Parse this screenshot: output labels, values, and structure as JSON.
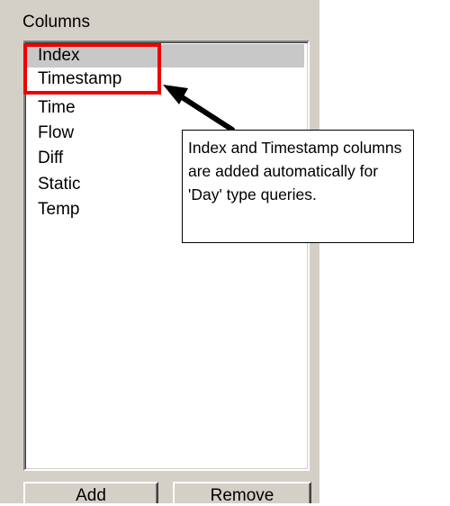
{
  "panel": {
    "group_label": "Columns",
    "columns": [
      {
        "label": "Index",
        "selected": true
      },
      {
        "label": "Timestamp",
        "selected": false
      },
      {
        "label": "Time",
        "selected": false
      },
      {
        "label": "Flow",
        "selected": false
      },
      {
        "label": "Diff",
        "selected": false
      },
      {
        "label": "Static",
        "selected": false
      },
      {
        "label": "Temp",
        "selected": false
      }
    ],
    "add_label": "Add",
    "remove_label": "Remove"
  },
  "annotation": {
    "callout_text": "Index and Timestamp columns are added automatically for 'Day' type queries.",
    "highlight_color": "#ee0000",
    "arrow_color": "#000000"
  },
  "colors": {
    "panel_bg": "#d4d0c8",
    "list_bg": "#ffffff",
    "selection_bg": "#c8c8c8"
  }
}
